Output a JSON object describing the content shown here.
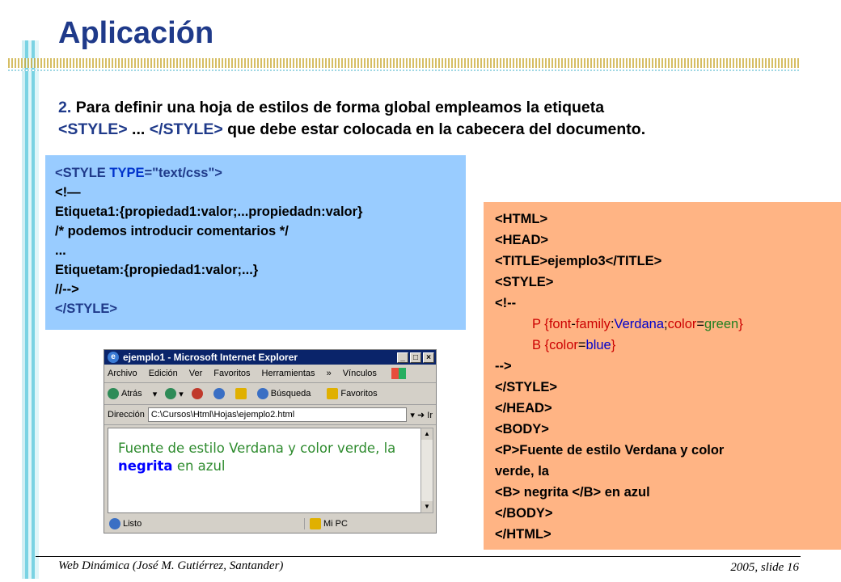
{
  "slide": {
    "title": "Aplicación",
    "intro_num": "2.",
    "intro_text1": "Para definir una hoja de estilos de forma global empleamos  la etiqueta",
    "intro_tag1": "<STYLE>",
    "intro_dots": " ... ",
    "intro_tag2": "</STYLE>",
    "intro_text2": " que debe estar colocada en la cabecera del documento."
  },
  "code_global": {
    "l1_open": "<STYLE ",
    "l1_attr": "TYPE",
    "l1_eq": "=\"",
    "l1_val": "text/css",
    "l1_close": "\">",
    "l2": "<!—",
    "l3": "Etiqueta1:{propiedad1:valor;...propiedadn:valor}",
    "l4": "/* podemos introducir comentarios */",
    "l5": "...",
    "l6": "Etiquetam:{propiedad1:valor;...}",
    "l7": "//-->",
    "l8": "</STYLE>"
  },
  "code_example": {
    "l1": "<HTML>",
    "l2": "<HEAD>",
    "l3a": "<TITLE>",
    "l3b": "ejemplo3",
    "l3c": "</TITLE>",
    "l4": "<STYLE>",
    "l5": "<!--",
    "l6_p": "P {",
    "l6_font": "font",
    "l6_dash": "-",
    "l6_family": "family",
    "l6_colon": ":",
    "l6_verdana": "Verdana",
    "l6_semi": ";",
    "l6_color": "color",
    "l6_eq": "=",
    "l6_green": "green",
    "l6_end": "}",
    "l7_b": "B {",
    "l7_color": "color",
    "l7_eq": "=",
    "l7_blue": "blue",
    "l7_end": "}",
    "l8": "-->",
    "l9": "</STYLE>",
    "l10": "</HEAD>",
    "l11": "<BODY>",
    "l12": "<P>Fuente de estilo Verdana y color",
    "l13": "verde, la",
    "l14a": "<B>",
    "l14b": " negrita ",
    "l14c": "</B>",
    "l14d": " en azul",
    "l15": "</BODY>",
    "l16": "</HTML>"
  },
  "browser": {
    "title": "ejemplo1 - Microsoft Internet Explorer",
    "menu": [
      "Archivo",
      "Edición",
      "Ver",
      "Favoritos",
      "Herramientas",
      "»",
      "Vínculos"
    ],
    "toolbar": {
      "back": "Atrás",
      "search": "Búsqueda",
      "favorites": "Favoritos"
    },
    "address_label": "Dirección",
    "address_value": "C:\\Cursos\\Html\\Hojas\\ejemplo2.html",
    "go": "Ir",
    "content_text1": "Fuente de estilo Verdana y color verde, la ",
    "content_bold": "negrita",
    "content_text2": " en azul",
    "status_left": "Listo",
    "status_right": "Mi PC"
  },
  "footer": {
    "left": "Web Dinámica (José M. Gutiérrez, Santander)",
    "right": "2005, slide 16"
  }
}
